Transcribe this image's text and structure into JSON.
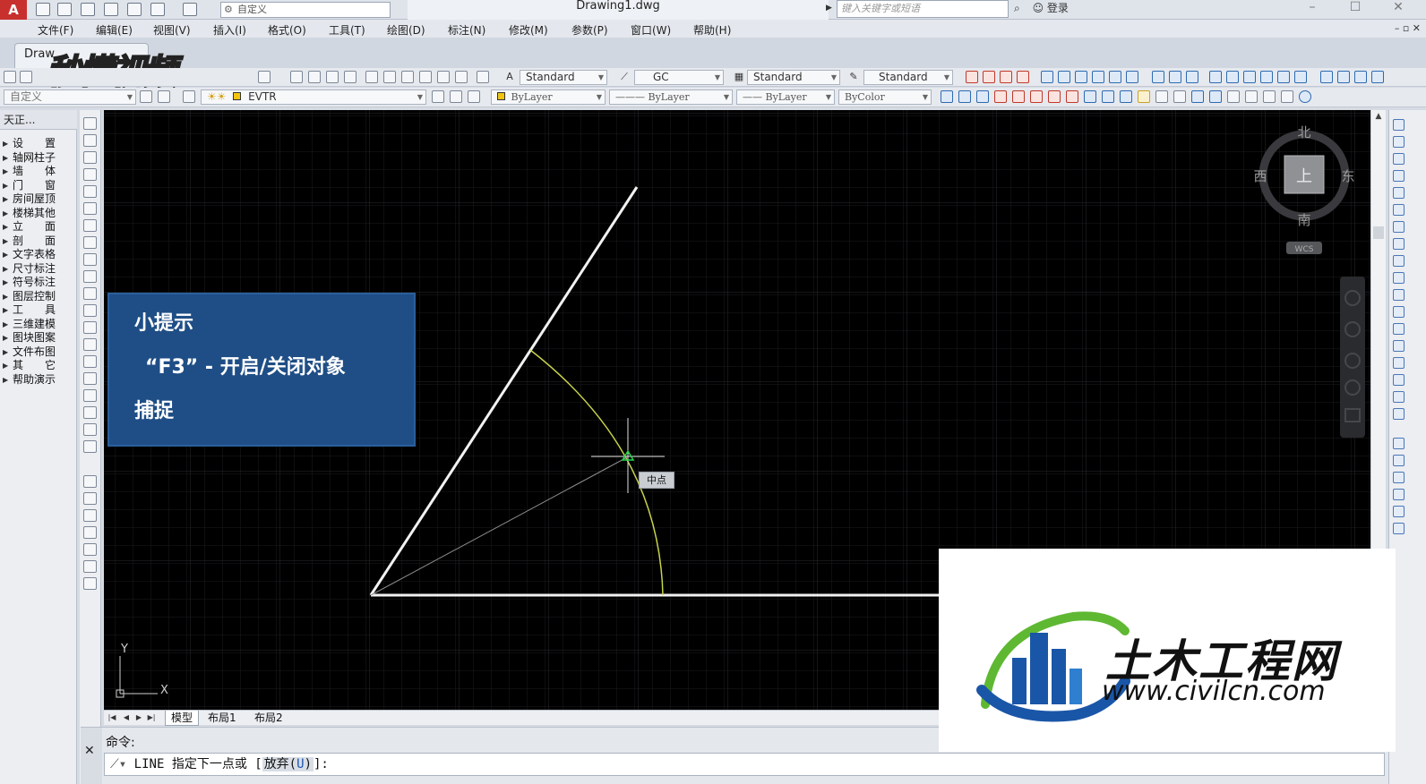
{
  "titlebar": {
    "app_logo": "A",
    "workspace": "自定义",
    "document_title": "Drawing1.dwg",
    "search_placeholder": "键入关键字或短语",
    "login": "登录"
  },
  "menu": [
    "文件(F)",
    "编辑(E)",
    "视图(V)",
    "插入(I)",
    "格式(O)",
    "工具(T)",
    "绘图(D)",
    "标注(N)",
    "修改(M)",
    "参数(P)",
    "窗口(W)",
    "帮助(H)"
  ],
  "file_tab": "Draw",
  "watermark_top": "秒懂视频",
  "toolbar": {
    "text_style": "Standard",
    "dim_style": "GC",
    "table_style": "Standard",
    "multileader_style": "Standard",
    "workspace2": "自定义",
    "layer": "EVTR",
    "color": "ByLayer",
    "linetype": "ByLayer",
    "lineweight": "ByLayer",
    "plotstyle": "ByColor"
  },
  "tz_panel": {
    "title": "天正...",
    "items": [
      "设　　置",
      "轴网柱子",
      "墙　　体",
      "门　　窗",
      "房间屋顶",
      "楼梯其他",
      "立　　面",
      "剖　　面",
      "文字表格",
      "尺寸标注",
      "符号标注",
      "图层控制",
      "工　　具",
      "三维建模",
      "图块图案",
      "文件布图",
      "其　　它",
      "帮助演示"
    ]
  },
  "viewcube": {
    "north": "北",
    "south": "南",
    "east": "东",
    "west": "西",
    "top": "上",
    "wcs": "WCS"
  },
  "ucs": {
    "x": "X",
    "y": "Y"
  },
  "snap_tooltip": "中点",
  "tip": {
    "title": "小提示",
    "line1": "“F3” - 开启/关闭对象",
    "line2": "捕捉"
  },
  "layout_tabs": [
    "模型",
    "布局1",
    "布局2"
  ],
  "command": {
    "history": "命令:",
    "prompt_prefix": "LINE 指定下一点或 [",
    "option_text": "放弃(",
    "option_key": "U",
    "option_close": ")",
    "prompt_suffix": "]:"
  },
  "watermark_bottom": {
    "name": "土木工程网",
    "url": "www.civilcn.com"
  },
  "colors": {
    "canvas_bg": "#000000",
    "tip_bg": "#1f4e86",
    "arc": "#c8d24a",
    "snap_marker": "#22d64a",
    "logo_blue": "#1a56a8",
    "logo_green": "#5fb832"
  }
}
